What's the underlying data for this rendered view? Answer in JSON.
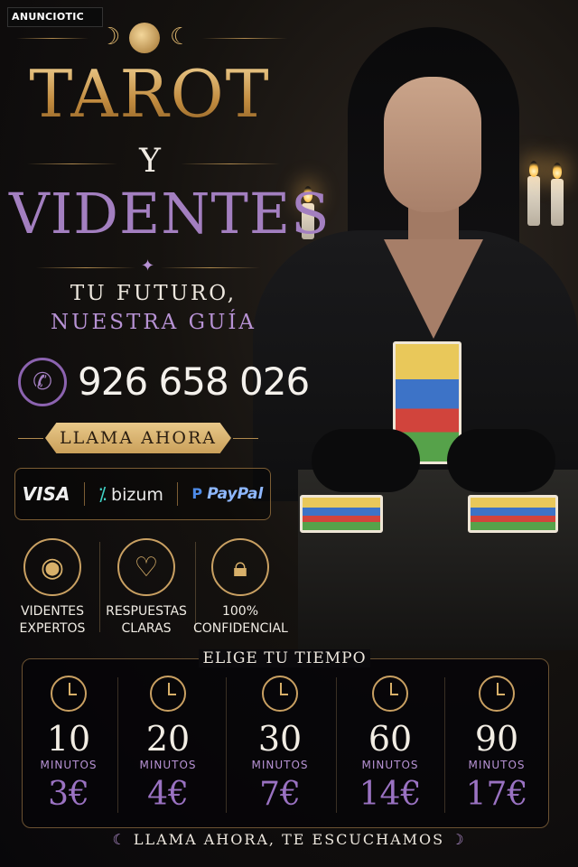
{
  "watermark": {
    "logo_text": "ANUNCIOTIC"
  },
  "title": {
    "line1": "TAROT",
    "connector": "Y",
    "line2": "VIDENTES"
  },
  "tagline": {
    "line1": "TU FUTURO,",
    "line2": "NUESTRA GUÍA"
  },
  "contact": {
    "phone_icon": "phone-icon",
    "phone": "926 658 026",
    "cta": "LLAMA AHORA"
  },
  "payments": {
    "visa": "VISA",
    "bizum": "bizum",
    "paypal": "PayPal"
  },
  "features": [
    {
      "icon": "crystal-ball-icon",
      "label1": "VIDENTES",
      "label2": "EXPERTOS"
    },
    {
      "icon": "heart-icon",
      "label1": "RESPUESTAS",
      "label2": "CLARAS"
    },
    {
      "icon": "lock-icon",
      "label1": "100%",
      "label2": "CONFIDENCIAL"
    }
  ],
  "pricing": {
    "heading": "ELIGE TU TIEMPO",
    "unit": "MINUTOS",
    "plans": [
      {
        "minutes": "10",
        "price": "3€"
      },
      {
        "minutes": "20",
        "price": "4€"
      },
      {
        "minutes": "30",
        "price": "7€"
      },
      {
        "minutes": "60",
        "price": "14€"
      },
      {
        "minutes": "90",
        "price": "17€"
      }
    ]
  },
  "footer": {
    "text": "LLAMA AHORA, TE ESCUCHAMOS"
  },
  "colors": {
    "gold": "#d6a85a",
    "purple": "#a37fc0",
    "background": "#0b0a0d"
  }
}
